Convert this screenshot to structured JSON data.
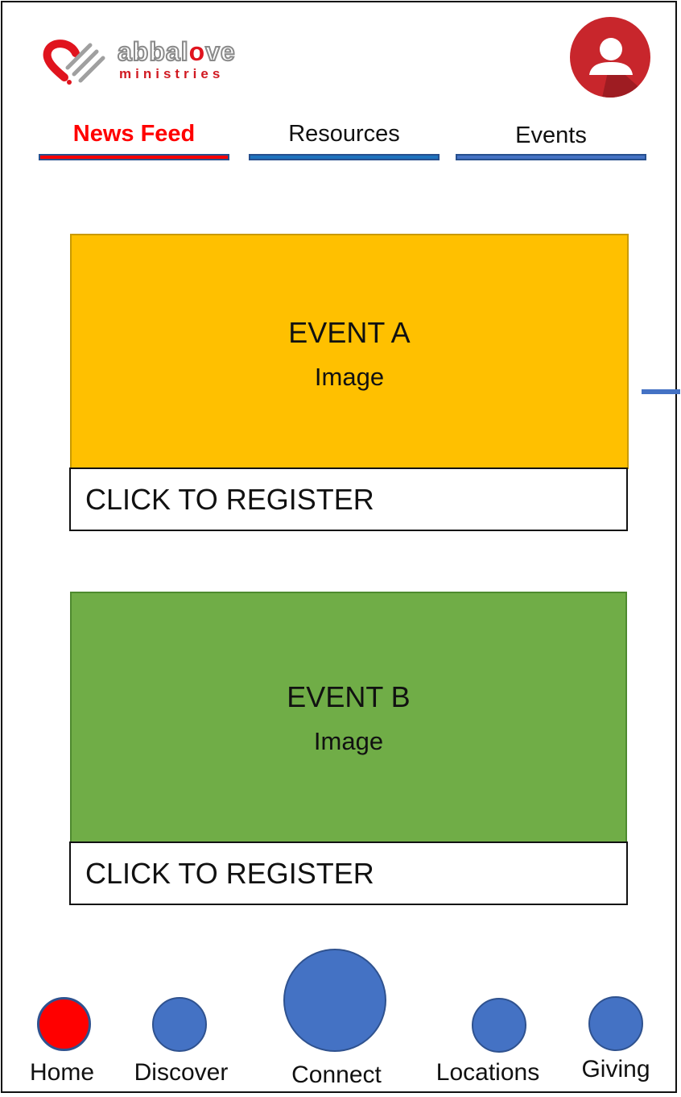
{
  "header": {
    "logo": {
      "line1_a": "abbal",
      "line1_o": "o",
      "line1_b": "ve",
      "line2": "ministries"
    }
  },
  "tabs": [
    {
      "label": "News Feed",
      "active": true
    },
    {
      "label": "Resources",
      "active": false
    },
    {
      "label": "Events",
      "active": false
    }
  ],
  "events": [
    {
      "title": "EVENT A",
      "subtitle": "Image",
      "cta": "CLICK TO REGISTER",
      "color": "#ffc000"
    },
    {
      "title": "EVENT B",
      "subtitle": "Image",
      "cta": "CLICK TO REGISTER",
      "color": "#70ad47"
    }
  ],
  "bottom_nav": [
    {
      "label": "Home",
      "active": true
    },
    {
      "label": "Discover",
      "active": false
    },
    {
      "label": "Connect",
      "active": false
    },
    {
      "label": "Locations",
      "active": false
    },
    {
      "label": "Giving",
      "active": false
    }
  ],
  "colors": {
    "accent_red": "#ff0000",
    "nav_blue": "#4472c4",
    "avatar_red": "#c8262c"
  }
}
